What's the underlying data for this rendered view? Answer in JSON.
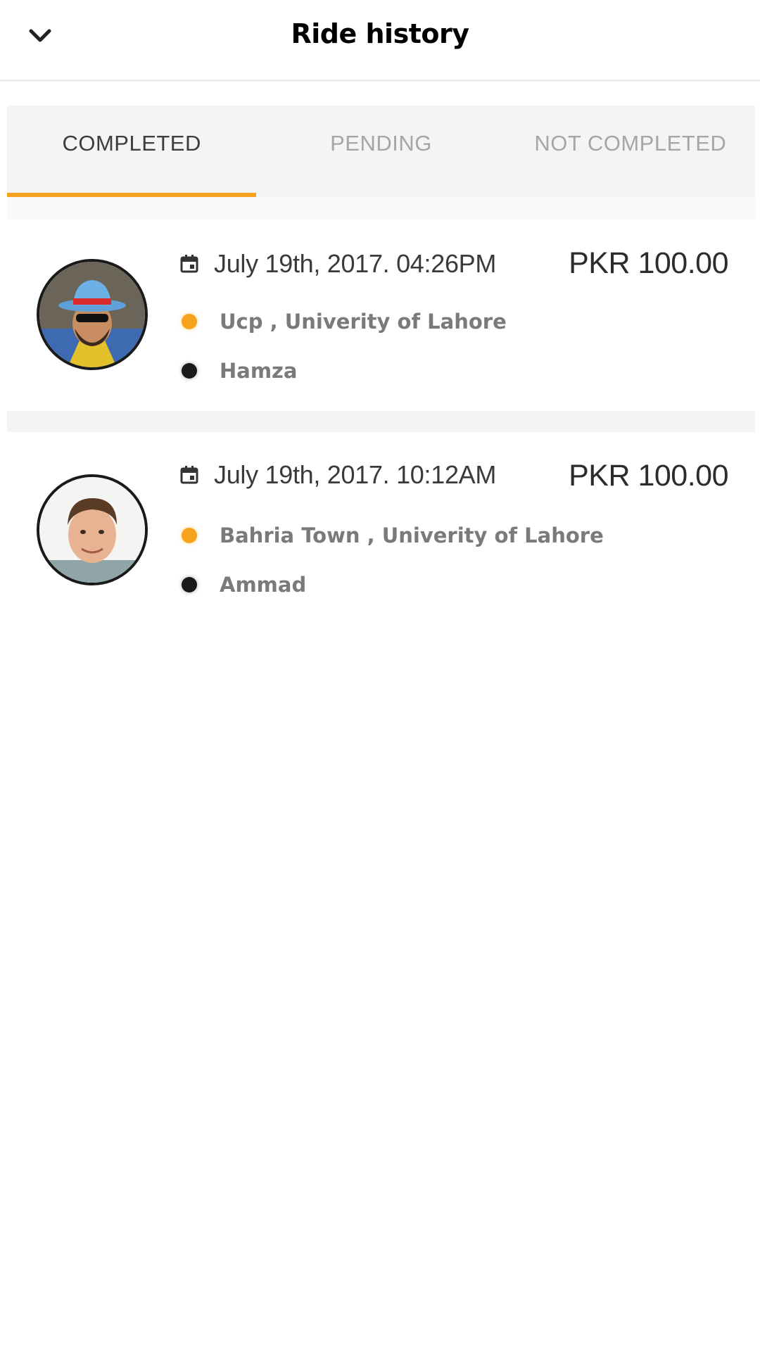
{
  "header": {
    "title": "Ride history",
    "back_icon": "chevron-down-icon"
  },
  "tabs": [
    {
      "label": "COMPLETED",
      "active": true
    },
    {
      "label": "PENDING",
      "active": false
    },
    {
      "label": "NOT COMPLETED",
      "active": false
    }
  ],
  "colors": {
    "accent": "#f7a21c",
    "driver_dot": "#1a1a1a",
    "tab_bg": "#f4f4f4"
  },
  "rides": [
    {
      "datetime": "July 19th, 2017. 04:26PM",
      "fare": "PKR 100.00",
      "route": "Ucp , Univerity of Lahore",
      "driver": "Hamza"
    },
    {
      "datetime": "July 19th, 2017. 10:12AM",
      "fare": "PKR 100.00",
      "route": "Bahria Town , Univerity of Lahore",
      "driver": "Ammad"
    }
  ]
}
